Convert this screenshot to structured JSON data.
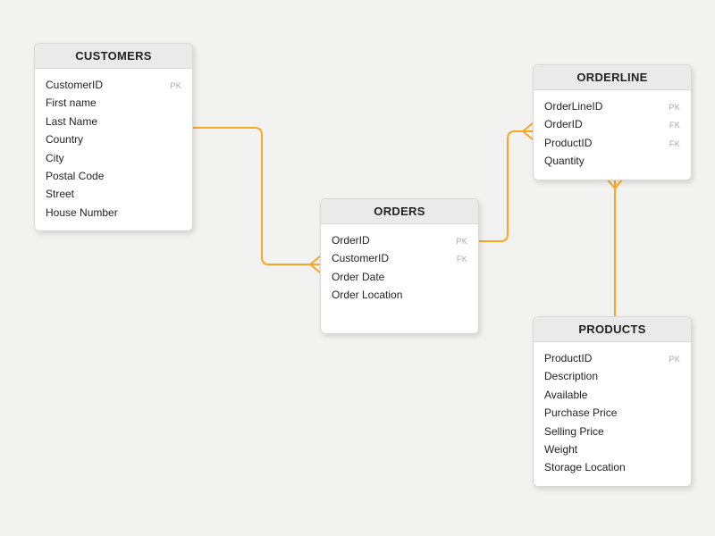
{
  "entities": {
    "customers": {
      "title": "CUSTOMERS",
      "fields": [
        {
          "name": "CustomerID",
          "key": "PK"
        },
        {
          "name": "First name",
          "key": ""
        },
        {
          "name": "Last Name",
          "key": ""
        },
        {
          "name": "Country",
          "key": ""
        },
        {
          "name": "City",
          "key": ""
        },
        {
          "name": "Postal Code",
          "key": ""
        },
        {
          "name": "Street",
          "key": ""
        },
        {
          "name": "House Number",
          "key": ""
        }
      ]
    },
    "orders": {
      "title": "ORDERS",
      "fields": [
        {
          "name": "OrderID",
          "key": "PK"
        },
        {
          "name": "CustomerID",
          "key": "FK"
        },
        {
          "name": "Order Date",
          "key": ""
        },
        {
          "name": "Order Location",
          "key": ""
        }
      ]
    },
    "orderline": {
      "title": "ORDERLINE",
      "fields": [
        {
          "name": "OrderLineID",
          "key": "PK"
        },
        {
          "name": "OrderID",
          "key": "FK"
        },
        {
          "name": "ProductID",
          "key": "FK"
        },
        {
          "name": "Quantity",
          "key": ""
        }
      ]
    },
    "products": {
      "title": "PRODUCTS",
      "fields": [
        {
          "name": "ProductID",
          "key": "PK"
        },
        {
          "name": "Description",
          "key": ""
        },
        {
          "name": "Available",
          "key": ""
        },
        {
          "name": "Purchase Price",
          "key": ""
        },
        {
          "name": "Selling Price",
          "key": ""
        },
        {
          "name": "Weight",
          "key": ""
        },
        {
          "name": "Storage Location",
          "key": ""
        }
      ]
    }
  },
  "relationships": [
    {
      "from": "customers",
      "to": "orders",
      "type": "one-to-many"
    },
    {
      "from": "orders",
      "to": "orderline",
      "type": "one-to-many"
    },
    {
      "from": "products",
      "to": "orderline",
      "type": "one-to-many"
    }
  ],
  "colors": {
    "connector": "#f7a823"
  }
}
